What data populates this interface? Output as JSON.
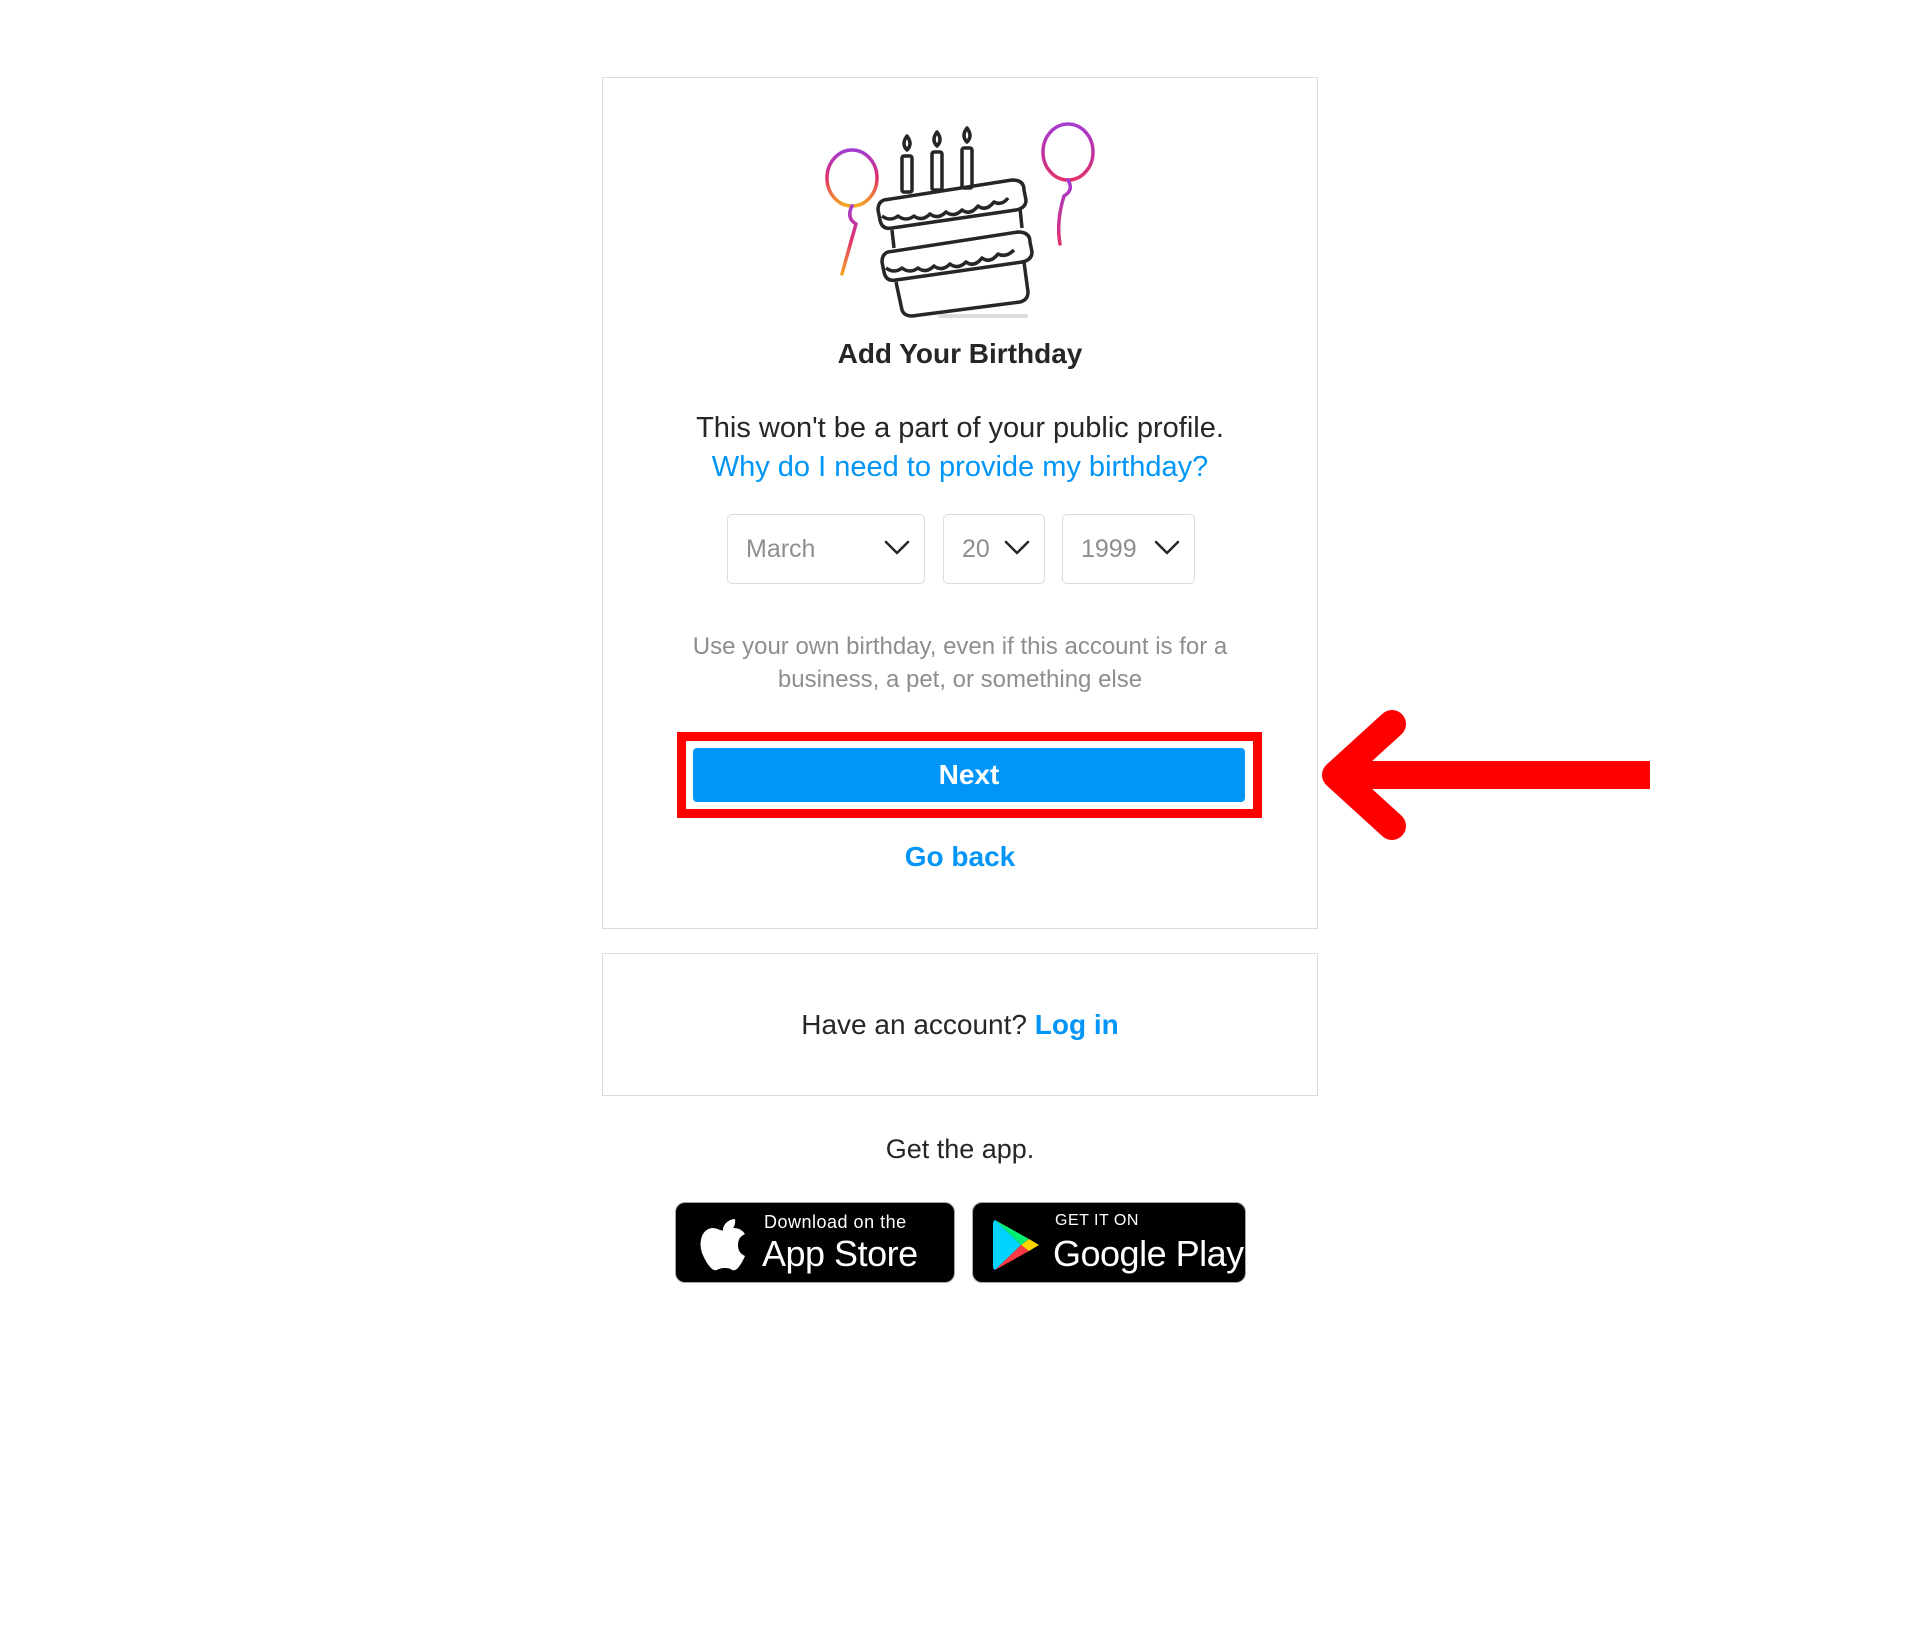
{
  "card": {
    "title": "Add Your Birthday",
    "subtitle": "This won't be a part of your public profile.",
    "why_link": "Why do I need to provide my birthday?",
    "month": "March",
    "day": "20",
    "year": "1999",
    "note": "Use your own birthday, even if this account is for a business, a pet, or something else",
    "next_label": "Next",
    "go_back_label": "Go back"
  },
  "login": {
    "prompt": "Have an account?",
    "link": "Log in"
  },
  "app": {
    "get_app": "Get the app.",
    "apple_small": "Download on the",
    "apple_big": "App Store",
    "google_small": "GET IT ON",
    "google_big": "Google Play"
  },
  "icons": {
    "illustration": "birthday-cake-icon",
    "chevron": "chevron-down-icon",
    "annotation": "red-arrow-icon",
    "apple": "apple-logo-icon",
    "google": "google-play-logo-icon"
  },
  "colors": {
    "accent": "#0095f6",
    "annotation": "#ff0000",
    "border": "#dbdbdb",
    "muted_text": "#8e8e8e"
  }
}
